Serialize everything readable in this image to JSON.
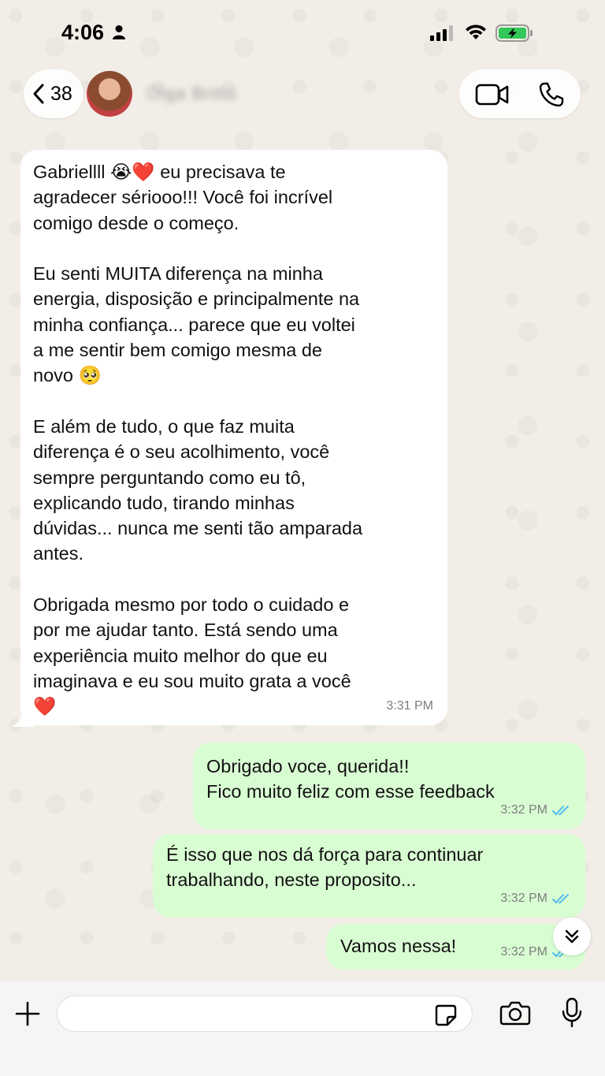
{
  "status_bar": {
    "time": "4:06"
  },
  "header": {
    "back_count": "38",
    "contact_name": "Olga Britto"
  },
  "messages": [
    {
      "direction": "incoming",
      "text": "Gabriellll 😭❤️ eu precisava te\nagradecer sériooo!!! Você foi incrível\ncomigo desde o começo.\n\nEu senti MUITA diferença na minha\nenergia, disposição e principalmente na\nminha confiança... parece que eu voltei\na me sentir bem comigo mesma de\nnovo 🥺\n\nE além de tudo, o que faz muita\ndiferença é o seu acolhimento, você\nsempre perguntando como eu tô,\nexplicando tudo, tirando minhas\ndúvidas... nunca me senti tão amparada\nantes.\n\nObrigada mesmo por todo o cuidado e\npor me ajudar tanto. Está sendo uma\nexperiência muito melhor do que eu\nimaginava e eu sou muito grata a você\n❤️",
      "time": "3:31 PM"
    },
    {
      "direction": "outgoing",
      "text": "Obrigado voce, querida!!\nFico muito feliz com esse feedback",
      "time": "3:32 PM",
      "status": "read"
    },
    {
      "direction": "outgoing",
      "text": "É isso que nos dá força para continuar\ntrabalhando, neste proposito...",
      "time": "3:32 PM",
      "status": "read"
    },
    {
      "direction": "outgoing",
      "text": "Vamos nessa!",
      "time": "3:32 PM",
      "status": "read"
    }
  ],
  "composer": {
    "placeholder": ""
  },
  "colors": {
    "incoming_bubble": "#ffffff",
    "outgoing_bubble": "#d9fdd3",
    "read_check": "#53bdeb",
    "battery_fill": "#34c759"
  },
  "icons": [
    "person-icon",
    "signal-icon",
    "wifi-icon",
    "battery-charging-icon",
    "chevron-left-icon",
    "video-call-icon",
    "phone-call-icon",
    "double-check-icon",
    "chevron-double-down-icon",
    "plus-icon",
    "sticker-icon",
    "camera-icon",
    "microphone-icon"
  ]
}
